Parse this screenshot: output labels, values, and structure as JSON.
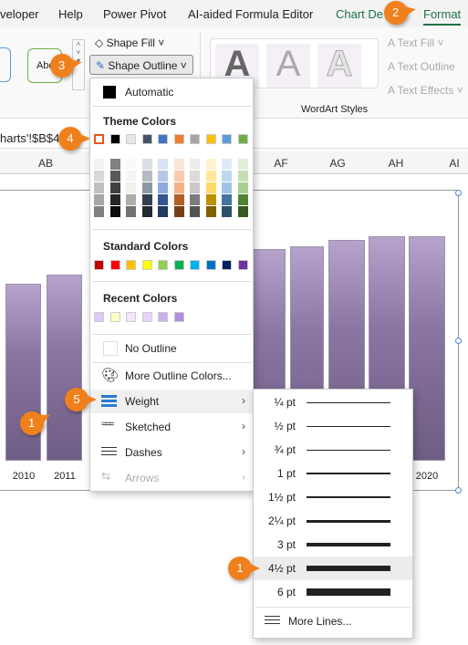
{
  "tabs": [
    "veloper",
    "Help",
    "Power Pivot",
    "AI-aided Formula Editor",
    "Chart De",
    "Format"
  ],
  "ribbon": {
    "shape_fill": "Shape Fill",
    "shape_outline": "Shape Outline",
    "style_preview": "Abc",
    "wordart_label": "WordArt Styles",
    "text_fill": "Text Fill",
    "text_outline": "Text Outline",
    "text_effects": "Text Effects",
    "wordart_glyph": "A"
  },
  "formula_text": "harts'!$B$4",
  "columns": [
    "AB",
    "AF",
    "AG",
    "AH",
    "AI"
  ],
  "chart": {
    "years_left": [
      "2010",
      "2011"
    ],
    "year_right": "2020"
  },
  "menu": {
    "automatic": "Automatic",
    "theme_colors": "Theme Colors",
    "standard_colors": "Standard Colors",
    "recent_colors": "Recent Colors",
    "no_outline": "No Outline",
    "more_colors": "More Outline Colors...",
    "weight": "Weight",
    "sketched": "Sketched",
    "dashes": "Dashes",
    "arrows": "Arrows"
  },
  "colors": {
    "theme": [
      "#ffffff",
      "#000000",
      "#e7e6e6",
      "#44546a",
      "#4472c4",
      "#ed7d31",
      "#a5a5a5",
      "#ffc000",
      "#5b9bd5",
      "#70ad47"
    ],
    "standard": [
      "#c00000",
      "#ff0000",
      "#ffc000",
      "#ffff00",
      "#92d050",
      "#00b050",
      "#00b0f0",
      "#0070c0",
      "#002060",
      "#7030a0"
    ],
    "recent": [
      "#e0c8f8",
      "#ffffcc",
      "#f4e6fc",
      "#e8d4fa",
      "#cdb0e8",
      "#b48ce0"
    ],
    "accent": "#f0801c"
  },
  "weights": [
    "¼ pt",
    "½ pt",
    "¾ pt",
    "1 pt",
    "1½ pt",
    "2¼ pt",
    "3 pt",
    "4½ pt",
    "6 pt"
  ],
  "weight_selected": "4½ pt",
  "more_lines": "More Lines...",
  "callouts": [
    "1",
    "2",
    "3",
    "4",
    "5",
    "1"
  ]
}
